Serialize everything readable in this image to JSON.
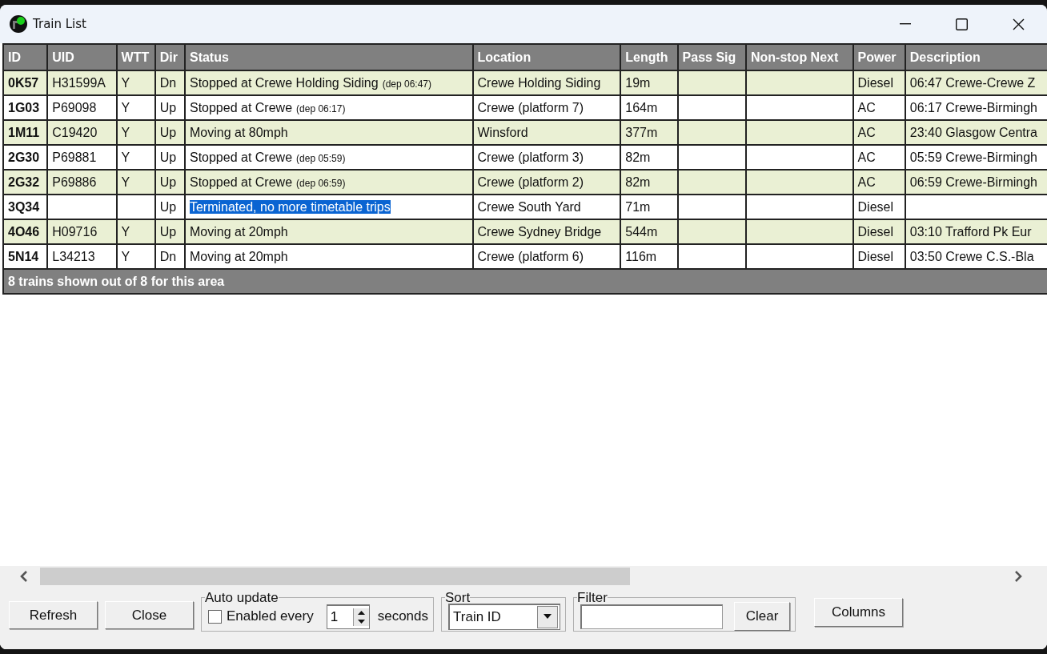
{
  "window": {
    "title": "Train List"
  },
  "table": {
    "columns": [
      "ID",
      "UID",
      "WTT",
      "Dir",
      "Status",
      "Location",
      "Length",
      "Pass Sig",
      "Non-stop Next",
      "Power",
      "Description"
    ],
    "rows": [
      {
        "id": "0K57",
        "uid": "H31599A",
        "wtt": "Y",
        "dir": "Dn",
        "status": "Stopped at Crewe Holding Siding",
        "status_note": "(dep 06:47)",
        "status_selected": false,
        "location": "Crewe Holding Siding",
        "length": "19m",
        "power": "Diesel",
        "description": "06:47 Crewe-Crewe Z"
      },
      {
        "id": "1G03",
        "uid": "P69098",
        "wtt": "Y",
        "dir": "Up",
        "status": "Stopped at Crewe",
        "status_note": "(dep 06:17)",
        "status_selected": false,
        "location": "Crewe (platform 7)",
        "length": "164m",
        "power": "AC",
        "description": "06:17 Crewe-Birmingh"
      },
      {
        "id": "1M11",
        "uid": "C19420",
        "wtt": "Y",
        "dir": "Up",
        "status": "Moving at 80mph",
        "status_selected": false,
        "location": "Winsford",
        "length": "377m",
        "power": "AC",
        "description": "23:40 Glasgow Centra"
      },
      {
        "id": "2G30",
        "uid": "P69881",
        "wtt": "Y",
        "dir": "Up",
        "status": "Stopped at Crewe",
        "status_note": "(dep 05:59)",
        "status_selected": false,
        "location": "Crewe (platform 3)",
        "length": "82m",
        "power": "AC",
        "description": "05:59 Crewe-Birmingh"
      },
      {
        "id": "2G32",
        "uid": "P69886",
        "wtt": "Y",
        "dir": "Up",
        "status": "Stopped at Crewe",
        "status_note": "(dep 06:59)",
        "status_selected": false,
        "location": "Crewe (platform 2)",
        "length": "82m",
        "power": "AC",
        "description": "06:59 Crewe-Birmingh"
      },
      {
        "id": "3Q34",
        "dir": "Up",
        "status": "Terminated, no more timetable trips",
        "status_selected": true,
        "location": "Crewe South Yard",
        "length": "71m",
        "power": "Diesel"
      },
      {
        "id": "4O46",
        "uid": "H09716",
        "wtt": "Y",
        "dir": "Up",
        "status": "Moving at 20mph",
        "status_selected": false,
        "location": "Crewe Sydney Bridge",
        "length": "544m",
        "power": "Diesel",
        "description": "03:10 Trafford Pk Eur"
      },
      {
        "id": "5N14",
        "uid": "L34213",
        "wtt": "Y",
        "dir": "Dn",
        "status": "Moving at 20mph",
        "status_selected": false,
        "location": "Crewe (platform 6)",
        "length": "116m",
        "power": "Diesel",
        "description": "03:50 Crewe C.S.-Bla"
      }
    ],
    "footer": "8 trains shown out of 8 for this area"
  },
  "controls": {
    "refresh": "Refresh",
    "close": "Close",
    "auto_update": {
      "label": "Auto update",
      "checkbox_label": "Enabled every",
      "checked": false,
      "interval": "1",
      "unit": "seconds"
    },
    "sort": {
      "label": "Sort",
      "value": "Train ID"
    },
    "filter": {
      "label": "Filter",
      "clear": "Clear"
    },
    "columns": "Columns"
  }
}
